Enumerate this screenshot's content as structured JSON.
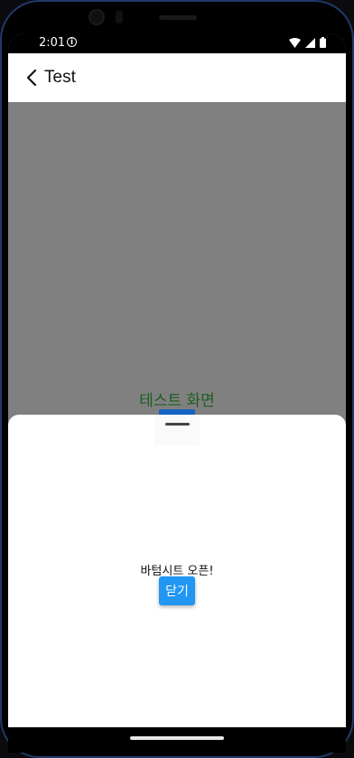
{
  "status_bar": {
    "time": "2:01"
  },
  "app_bar": {
    "title": "Test"
  },
  "content": {
    "title": "테스트 화면"
  },
  "bottom_sheet": {
    "message": "바텀시트 오픈!",
    "close_label": "닫기"
  },
  "colors": {
    "content_title": "#1b5e20",
    "close_button": "#2196f3",
    "overlay": "#808080"
  }
}
